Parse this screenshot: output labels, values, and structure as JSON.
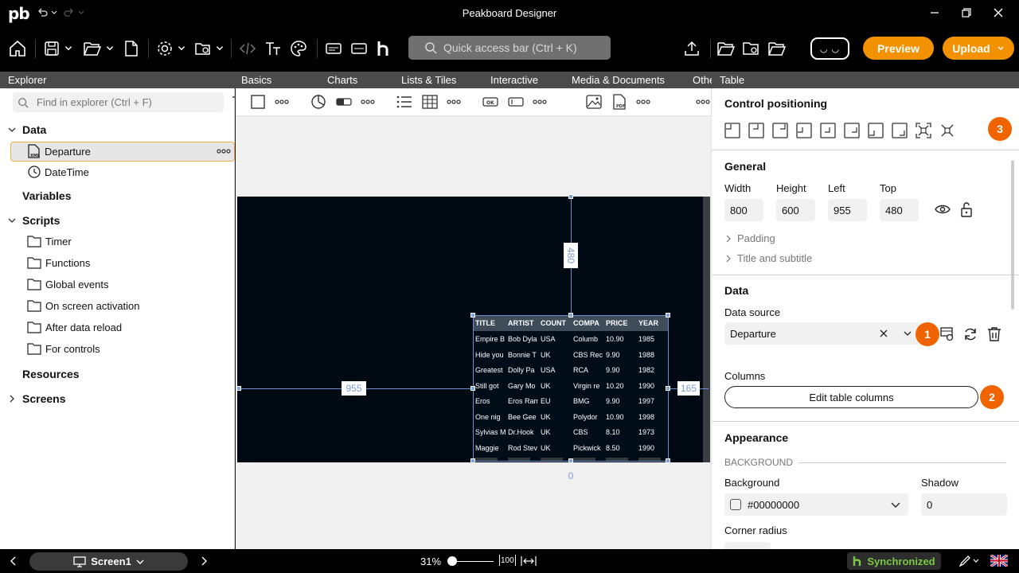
{
  "app": {
    "logo": "pb",
    "title": "Peakboard Designer"
  },
  "toolbar": {
    "quick_access_placeholder": "Quick access bar (Ctrl + K)",
    "avatar_face": "◡ ◡",
    "preview_label": "Preview",
    "upload_label": "Upload"
  },
  "header_strip": {
    "explorer": "Explorer",
    "tabs": [
      "Basics",
      "Charts",
      "Lists & Tiles",
      "Interactive",
      "Media & Documents",
      "Othe"
    ],
    "properties": "Table"
  },
  "explorer": {
    "search_placeholder": "Find in explorer (Ctrl + F)",
    "data_section": "Data",
    "data_items": [
      "Departure",
      "DateTime"
    ],
    "variables": "Variables",
    "scripts_section": "Scripts",
    "script_items": [
      "Timer",
      "Functions",
      "Global events",
      "On screen activation",
      "After data reload",
      "For controls"
    ],
    "resources": "Resources",
    "screens": "Screens"
  },
  "canvas": {
    "top_distance": "480",
    "left_distance": "955",
    "right_distance": "165",
    "bottom_distance": "0"
  },
  "table": {
    "columns": [
      "TITLE",
      "ARTIST",
      "COUNT",
      "COMPA",
      "PRICE",
      "YEAR"
    ],
    "rows": [
      [
        "Empire B",
        "Bob Dyla",
        "USA",
        "Columb",
        "10.90",
        "1985"
      ],
      [
        "Hide you",
        "Bonnie T",
        "UK",
        "CBS Rec",
        "9.90",
        "1988"
      ],
      [
        "Greatest",
        "Dolly Pa",
        "USA",
        "RCA",
        "9.90",
        "1982"
      ],
      [
        "Still got",
        "Gary Mo",
        "UK",
        "Virgin re",
        "10.20",
        "1990"
      ],
      [
        "Eros",
        "Eros Ram",
        "EU",
        "BMG",
        "9.90",
        "1997"
      ],
      [
        "One nig",
        "Bee Gee",
        "UK",
        "Polydor",
        "10.90",
        "1998"
      ],
      [
        "Sylvias M",
        "Dr.Hook",
        "UK",
        "CBS",
        "8.10",
        "1973"
      ],
      [
        "Maggie",
        "Rod Stev",
        "UK",
        "Pickwick",
        "8.50",
        "1990"
      ]
    ]
  },
  "props": {
    "control_positioning": "Control positioning",
    "general": "General",
    "width_label": "Width",
    "height_label": "Height",
    "left_label": "Left",
    "top_label": "Top",
    "width": "800",
    "height": "600",
    "left": "955",
    "top": "480",
    "padding": "Padding",
    "title_subtitle": "Title and subtitle",
    "data": "Data",
    "data_source_label": "Data source",
    "data_source": "Departure",
    "columns_label": "Columns",
    "edit_columns": "Edit table columns",
    "appearance": "Appearance",
    "background_section": "BACKGROUND",
    "background_label": "Background",
    "background_value": "#00000000",
    "shadow_label": "Shadow",
    "shadow_value": "0",
    "corner_radius_label": "Corner radius",
    "badges": [
      "1",
      "2",
      "3"
    ]
  },
  "statusbar": {
    "screen": "Screen1",
    "zoom": "31%",
    "zoom_100": "100",
    "synchronized": "Synchronized"
  },
  "colors": {
    "accent": "#f39200",
    "badge": "#f06400",
    "sync_green": "#7ac943",
    "screen_bg": "#010a13"
  }
}
